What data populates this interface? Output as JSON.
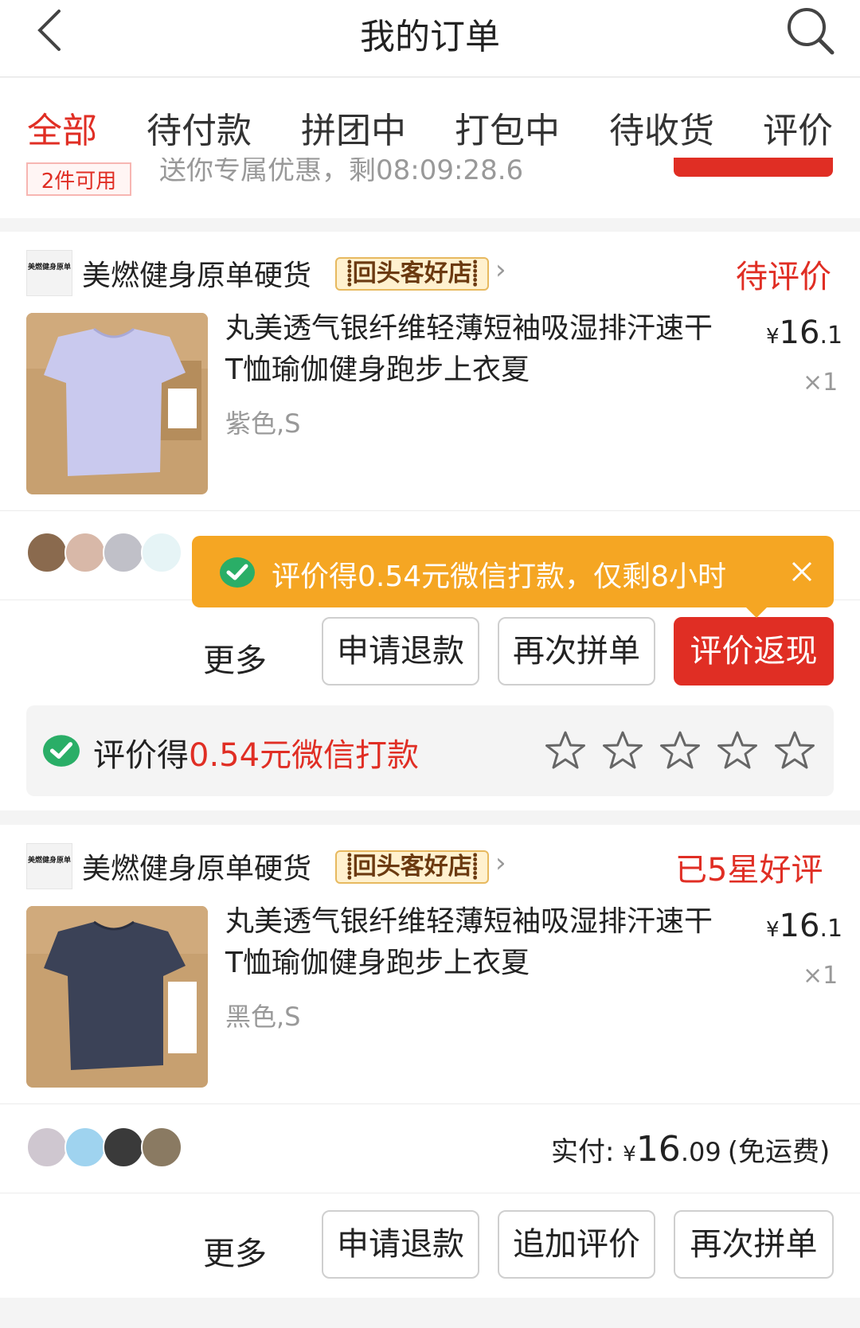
{
  "header": {
    "title": "我的订单"
  },
  "tabs": [
    {
      "label": "全部",
      "active": true
    },
    {
      "label": "待付款"
    },
    {
      "label": "拼团中"
    },
    {
      "label": "打包中"
    },
    {
      "label": "待收货"
    },
    {
      "label": "评价"
    }
  ],
  "coupon": {
    "badge": "2件可用",
    "text": "送你专属优惠，剩08:09:28.6"
  },
  "order1": {
    "store_logo_text": "美燃健身原单",
    "store_name": "美燃健身原单硬货",
    "store_badge": "回头客好店",
    "status": "待评价",
    "product_title": "丸美透气银纤维轻薄短袖吸湿排汗速干T恤瑜伽健身跑步上衣夏",
    "spec": "紫色,S",
    "price_symbol": "¥",
    "price_int": "16",
    "price_dec": ".1",
    "qty": "×1",
    "tip_text": "评价得0.54元微信打款，仅剩8小时",
    "more_label": "更多",
    "buttons": [
      "申请退款",
      "再次拼单",
      "评价返现"
    ],
    "rate_prefix": "评价得",
    "rate_amount": "0.54元微信打款"
  },
  "order2": {
    "store_logo_text": "美燃健身原单",
    "store_name": "美燃健身原单硬货",
    "store_badge": "回头客好店",
    "status": "已5星好评",
    "product_title": "丸美透气银纤维轻薄短袖吸湿排汗速干T恤瑜伽健身跑步上衣夏",
    "spec": "黑色,S",
    "price_symbol": "¥",
    "price_int": "16",
    "price_dec": ".1",
    "qty": "×1",
    "paid_label": "实付: ",
    "paid_symbol": "¥",
    "paid_int": "16",
    "paid_dec": ".09",
    "paid_note": "(免运费)",
    "more_label": "更多",
    "buttons": [
      "申请退款",
      "追加评价",
      "再次拼单"
    ]
  },
  "colors": {
    "accent": "#e02e24",
    "tip": "#f5a623",
    "wechat_green": "#2aae67"
  }
}
